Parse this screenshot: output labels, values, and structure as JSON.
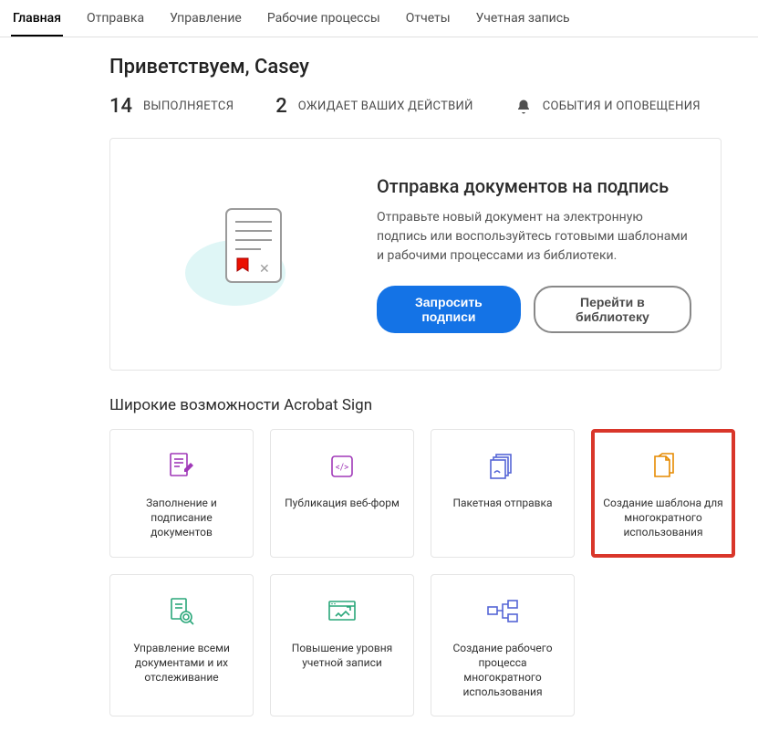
{
  "nav": {
    "items": [
      {
        "label": "Главная",
        "active": true
      },
      {
        "label": "Отправка"
      },
      {
        "label": "Управление"
      },
      {
        "label": "Рабочие процессы"
      },
      {
        "label": "Отчеты"
      },
      {
        "label": "Учетная запись"
      }
    ]
  },
  "greeting": "Приветствуем, Casey",
  "stats": {
    "in_progress": {
      "count": "14",
      "label": "ВЫПОЛНЯЕТСЯ"
    },
    "waiting": {
      "count": "2",
      "label": "ОЖИДАЕТ ВАШИХ ДЕЙСТВИЙ"
    },
    "alerts": {
      "label": "СОБЫТИЯ И ОПОВЕЩЕНИЯ"
    }
  },
  "hero": {
    "title": "Отправка документов на подпись",
    "desc": "Отправьте новый документ на электронную подпись или воспользуйтесь готовыми шаблонами и рабочими процессами из библиотеки.",
    "primary_btn": "Запросить подписи",
    "secondary_btn": "Перейти в библиотеку"
  },
  "section": {
    "title": "Широкие возможности Acrobat Sign",
    "cards": [
      {
        "label": "Заполнение и подписание документов",
        "icon": "fill-sign-icon"
      },
      {
        "label": "Публикация веб-форм",
        "icon": "webform-icon"
      },
      {
        "label": "Пакетная отправка",
        "icon": "bulk-send-icon"
      },
      {
        "label": "Создание шаблона для многократного использования",
        "icon": "template-icon",
        "highlight": true
      },
      {
        "label": "Управление всеми документами и их отслеживание",
        "icon": "manage-track-icon"
      },
      {
        "label": "Повышение уровня учетной записи",
        "icon": "upgrade-account-icon"
      },
      {
        "label": "Создание рабочего процесса многократного использования",
        "icon": "workflow-icon"
      }
    ]
  },
  "colors": {
    "primary": "#1473e6",
    "highlight_border": "#d9362a"
  }
}
